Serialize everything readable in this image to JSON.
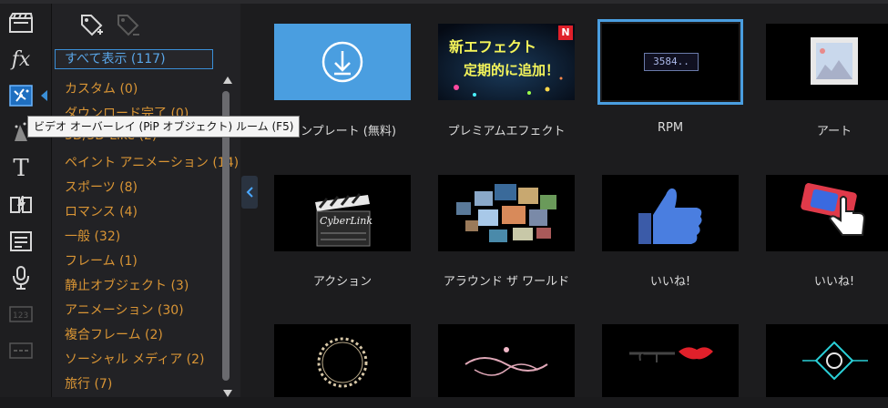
{
  "panel": {
    "categories": [
      {
        "label": "すべて表示 (117)",
        "selected": true
      },
      {
        "label": "カスタム (0)"
      },
      {
        "label": "ダウンロード完了 (0)"
      },
      {
        "label": "3D/3D-Like (2)"
      },
      {
        "label": "ペイント アニメーション (14)"
      },
      {
        "label": "スポーツ (8)"
      },
      {
        "label": "ロマンス (4)"
      },
      {
        "label": "一般 (32)"
      },
      {
        "label": "フレーム (1)"
      },
      {
        "label": "静止オブジェクト (3)"
      },
      {
        "label": "アニメーション (30)"
      },
      {
        "label": "複合フレーム (2)"
      },
      {
        "label": "ソーシャル メディア (2)"
      },
      {
        "label": "旅行 (7)"
      }
    ]
  },
  "tooltip": {
    "text": "ビデオ オーバーレイ (PiP オブジェクト) ルーム (F5)"
  },
  "templates": [
    {
      "label": "テンプレート (無料)",
      "thumb": "download"
    },
    {
      "label": "プレミアムエフェクト",
      "thumb": "premium",
      "banner_line1": "新エフェクト",
      "banner_line2": "定期的に追加！",
      "badge": "N"
    },
    {
      "label": "RPM",
      "thumb": "rpm",
      "counter": "3584..",
      "selected": true
    },
    {
      "label": "アート",
      "thumb": "art"
    },
    {
      "label": "アクション",
      "thumb": "clapper",
      "clapper_text": "CyberLink"
    },
    {
      "label": "アラウンド ザ ワールド",
      "thumb": "photos"
    },
    {
      "label": "いいね!",
      "thumb": "thumbsup"
    },
    {
      "label": "いいね!",
      "thumb": "hand"
    },
    {
      "label": "",
      "thumb": "circle-frame"
    },
    {
      "label": "",
      "thumb": "ornament"
    },
    {
      "label": "",
      "thumb": "lips"
    },
    {
      "label": "",
      "thumb": "badge"
    }
  ],
  "colors": {
    "accent": "#3a8fd8",
    "category_text": "#d99535",
    "selected_text": "#5aa6e8"
  }
}
